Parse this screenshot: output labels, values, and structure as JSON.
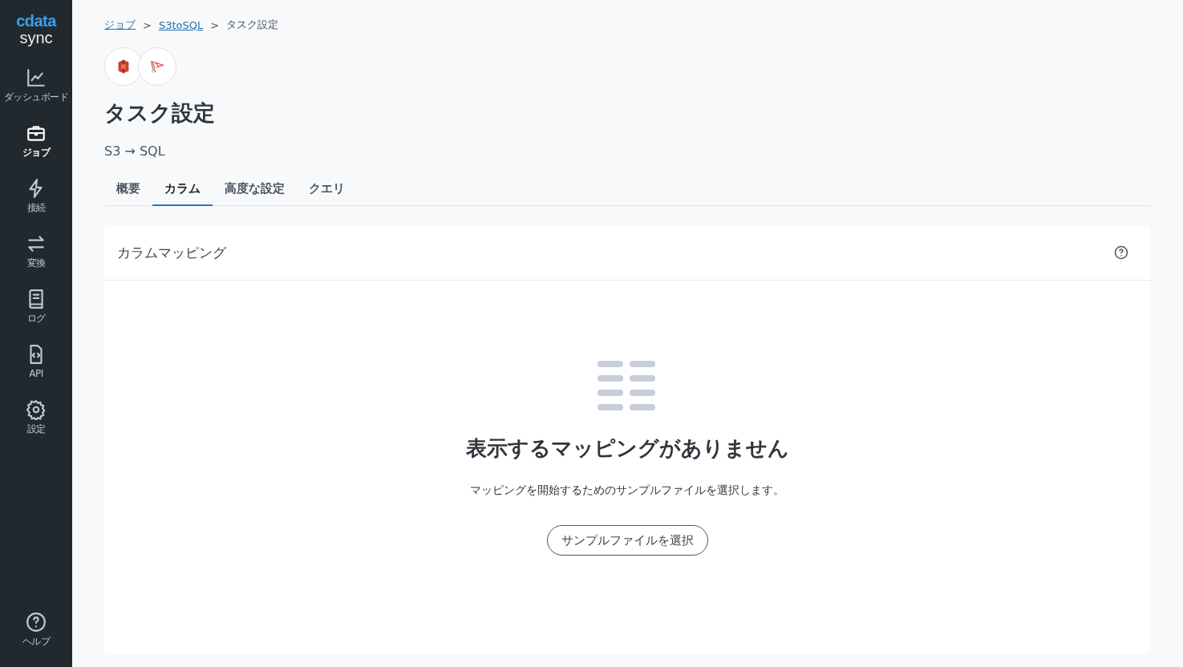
{
  "sidebar": {
    "logo": {
      "brand": "cdata",
      "product": "sync"
    },
    "items": [
      {
        "kind": "chart",
        "label": "ダッシュボード",
        "selected": false
      },
      {
        "kind": "briefcase",
        "label": "ジョブ",
        "selected": true
      },
      {
        "kind": "bolt",
        "label": "接続",
        "selected": false
      },
      {
        "kind": "swap",
        "label": "変換",
        "selected": false
      },
      {
        "kind": "book",
        "label": "ログ",
        "selected": false
      },
      {
        "kind": "code",
        "label": "API",
        "selected": false
      },
      {
        "kind": "gear",
        "label": "設定",
        "selected": false
      }
    ],
    "help": {
      "label": "ヘルプ"
    }
  },
  "breadcrumb": [
    {
      "label": "ジョブ",
      "link": true
    },
    {
      "label": "S3toSQL",
      "link": true
    },
    {
      "label": "タスク設定",
      "link": false
    }
  ],
  "separator": ">",
  "title": "タスク設定",
  "subtitle": "S3 → SQL",
  "tabs": [
    {
      "label": "概要",
      "selected": false
    },
    {
      "label": "カラム",
      "selected": true
    },
    {
      "label": "高度な設定",
      "selected": false
    },
    {
      "label": "クエリ",
      "selected": false
    }
  ],
  "panel": {
    "title": "カラムマッピング",
    "empty_title": "表示するマッピングがありません",
    "empty_text": "マッピングを開始するためのサンプルファイルを選択します。",
    "button": "サンプルファイルを選択"
  }
}
